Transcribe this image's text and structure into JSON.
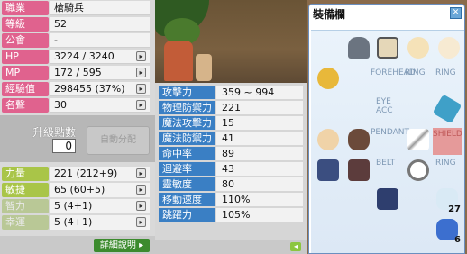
{
  "character": {
    "rows": [
      {
        "label": "職業",
        "value": "槍騎兵"
      },
      {
        "label": "等級",
        "value": "52"
      },
      {
        "label": "公會",
        "value": "-"
      },
      {
        "label": "HP",
        "value": "3224 / 3240"
      },
      {
        "label": "MP",
        "value": "172 / 595"
      },
      {
        "label": "經驗值",
        "value": "298455 (37%)"
      },
      {
        "label": "名聲",
        "value": "30"
      }
    ]
  },
  "ap": {
    "label": "升級點數",
    "value": "0",
    "auto_assign_label": "自動分配"
  },
  "stats": [
    {
      "label": "力量",
      "value": "221 (212+9)"
    },
    {
      "label": "敏捷",
      "value": "65 (60+5)"
    },
    {
      "label": "智力",
      "value": "5 (4+1)"
    },
    {
      "label": "幸運",
      "value": "5 (4+1)"
    }
  ],
  "detail_button_label": "詳細說明 ▸",
  "details": [
    {
      "label": "攻擊力",
      "value": "359 ~ 994"
    },
    {
      "label": "物理防禦力",
      "value": "221"
    },
    {
      "label": "魔法攻擊力",
      "value": "15"
    },
    {
      "label": "魔法防禦力",
      "value": "41"
    },
    {
      "label": "命中率",
      "value": "89"
    },
    {
      "label": "迴避率",
      "value": "43"
    },
    {
      "label": "靈敏度",
      "value": "80"
    },
    {
      "label": "移動速度",
      "value": "110%"
    },
    {
      "label": "跳躍力",
      "value": "105%"
    }
  ],
  "equipment": {
    "title": "裝備欄",
    "slot_labels": {
      "forehead": "FOREHEAD",
      "ring1": "RING",
      "ring2": "RING",
      "eye_acc": "EYE\nACC",
      "pendant": "PENDANT",
      "shield": "SHIELD",
      "belt": "BELT",
      "ring3": "RING"
    },
    "counts": [
      "27",
      "6"
    ]
  },
  "colors": {
    "char_label": "#e0628e",
    "stat_label": "#a9c548",
    "detail_label": "#3a7fc4",
    "shield_slot": "#e59a9a"
  }
}
